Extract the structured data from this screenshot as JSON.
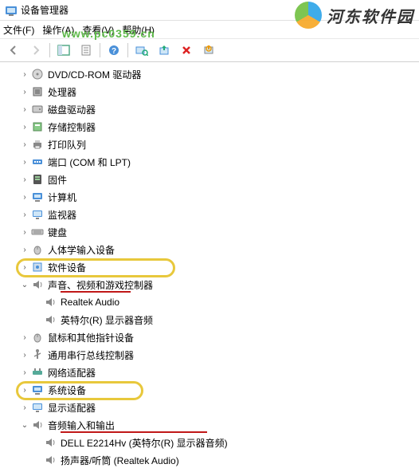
{
  "window": {
    "title": "设备管理器"
  },
  "menubar": {
    "file": "文件(F)",
    "action": "操作(A)",
    "view": "查看(V)",
    "help": "帮助(H)"
  },
  "watermark": {
    "brand": "河东软件园",
    "url": "www.pc0359.cn"
  },
  "tree": {
    "items": [
      {
        "label": "DVD/CD-ROM 驱动器",
        "icon": "disc",
        "expanded": false
      },
      {
        "label": "处理器",
        "icon": "cpu",
        "expanded": false
      },
      {
        "label": "磁盘驱动器",
        "icon": "disk",
        "expanded": false
      },
      {
        "label": "存储控制器",
        "icon": "storage",
        "expanded": false
      },
      {
        "label": "打印队列",
        "icon": "printer",
        "expanded": false
      },
      {
        "label": "端口 (COM 和 LPT)",
        "icon": "port",
        "expanded": false
      },
      {
        "label": "固件",
        "icon": "firmware",
        "expanded": false
      },
      {
        "label": "计算机",
        "icon": "computer",
        "expanded": false
      },
      {
        "label": "监视器",
        "icon": "monitor",
        "expanded": false
      },
      {
        "label": "键盘",
        "icon": "keyboard",
        "expanded": false
      },
      {
        "label": "人体学输入设备",
        "icon": "hid",
        "expanded": false
      },
      {
        "label": "软件设备",
        "icon": "software",
        "expanded": false
      },
      {
        "label": "声音、视频和游戏控制器",
        "icon": "audio",
        "expanded": true,
        "children": [
          {
            "label": "Realtek Audio",
            "icon": "audio"
          },
          {
            "label": "英特尔(R) 显示器音频",
            "icon": "audio"
          }
        ]
      },
      {
        "label": "鼠标和其他指针设备",
        "icon": "mouse",
        "expanded": false
      },
      {
        "label": "通用串行总线控制器",
        "icon": "usb",
        "expanded": false
      },
      {
        "label": "网络适配器",
        "icon": "network",
        "expanded": false
      },
      {
        "label": "系统设备",
        "icon": "system",
        "expanded": false
      },
      {
        "label": "显示适配器",
        "icon": "display",
        "expanded": false
      },
      {
        "label": "音频输入和输出",
        "icon": "audio",
        "expanded": true,
        "children": [
          {
            "label": "DELL E2214Hv (英特尔(R) 显示器音频)",
            "icon": "audio"
          },
          {
            "label": "扬声器/听筒 (Realtek Audio)",
            "icon": "audio"
          }
        ]
      }
    ]
  }
}
